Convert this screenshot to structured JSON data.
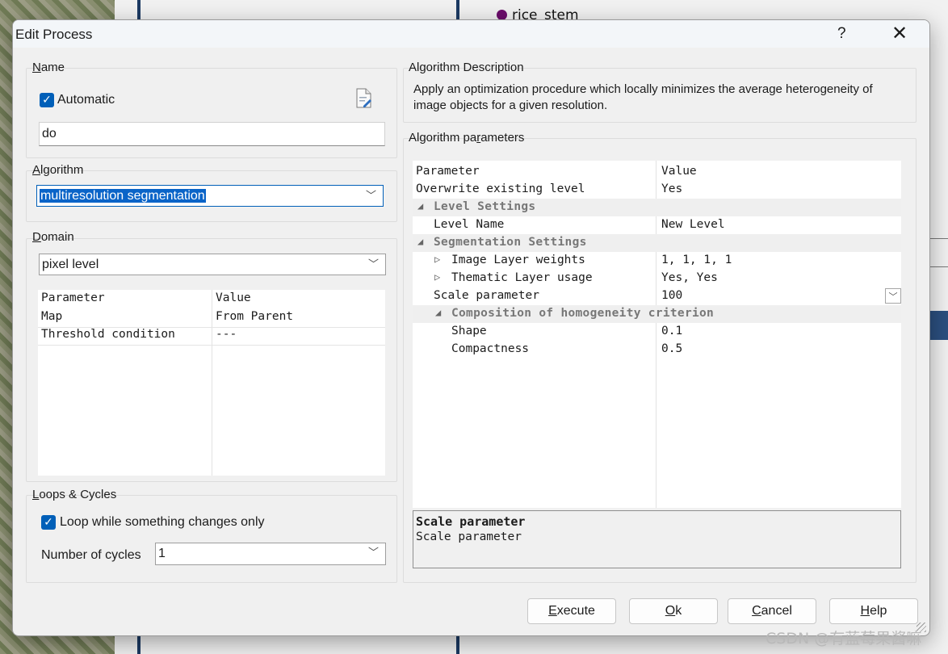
{
  "background": {
    "tree_items": [
      "rice_stem"
    ]
  },
  "dialog": {
    "title": "Edit Process",
    "help_button": "?",
    "close_button": "✕"
  },
  "name_section": {
    "label": "Name",
    "automatic_checked": true,
    "automatic_label": "Automatic",
    "name_value": "do",
    "edit_icon": "edit-document-icon"
  },
  "algorithm_section": {
    "label": "Algorithm",
    "selected": "multiresolution segmentation"
  },
  "domain_section": {
    "label": "Domain",
    "selected": "pixel level",
    "columns": [
      "Parameter",
      "Value"
    ],
    "rows": [
      {
        "parameter": "Map",
        "value": "From Parent"
      },
      {
        "parameter": "Threshold condition",
        "value": "---"
      }
    ]
  },
  "loops_section": {
    "label": "Loops & Cycles",
    "loop_checked": true,
    "loop_label": "Loop while something changes only",
    "cycles_label": "Number of cycles",
    "cycles_value": "1"
  },
  "description_section": {
    "label": "Algorithm Description",
    "text": "Apply an optimization procedure which locally minimizes the average heterogeneity of image objects for a given resolution."
  },
  "parameters_section": {
    "label": "Algorithm parameters",
    "columns": [
      "Parameter",
      "Value"
    ],
    "rows": [
      {
        "name": "Overwrite existing level",
        "value": "Yes"
      },
      {
        "name": "Level Settings",
        "category": true
      },
      {
        "name": "Level Name",
        "value": "New Level"
      },
      {
        "name": "Segmentation Settings",
        "category": true
      },
      {
        "name": "Image Layer weights",
        "value": "1, 1, 1, 1",
        "expandable": true
      },
      {
        "name": "Thematic Layer usage",
        "value": "Yes, Yes",
        "expandable": true
      },
      {
        "name": "Scale parameter",
        "value": "100",
        "dropdown": true
      },
      {
        "name": "Composition of homogeneity criterion",
        "category": true
      },
      {
        "name": "Shape",
        "value": "0.1"
      },
      {
        "name": "Compactness",
        "value": "0.5"
      }
    ],
    "help_title": "Scale parameter",
    "help_text": "Scale parameter"
  },
  "buttons": {
    "execute": "Execute",
    "ok": "Ok",
    "cancel": "Cancel",
    "help": "Help"
  },
  "watermark": "CSDN @有蓝莓果酱嘛",
  "colors": {
    "accent": "#005fb8",
    "selection": "#0a64c8",
    "category_text": "#777777"
  }
}
